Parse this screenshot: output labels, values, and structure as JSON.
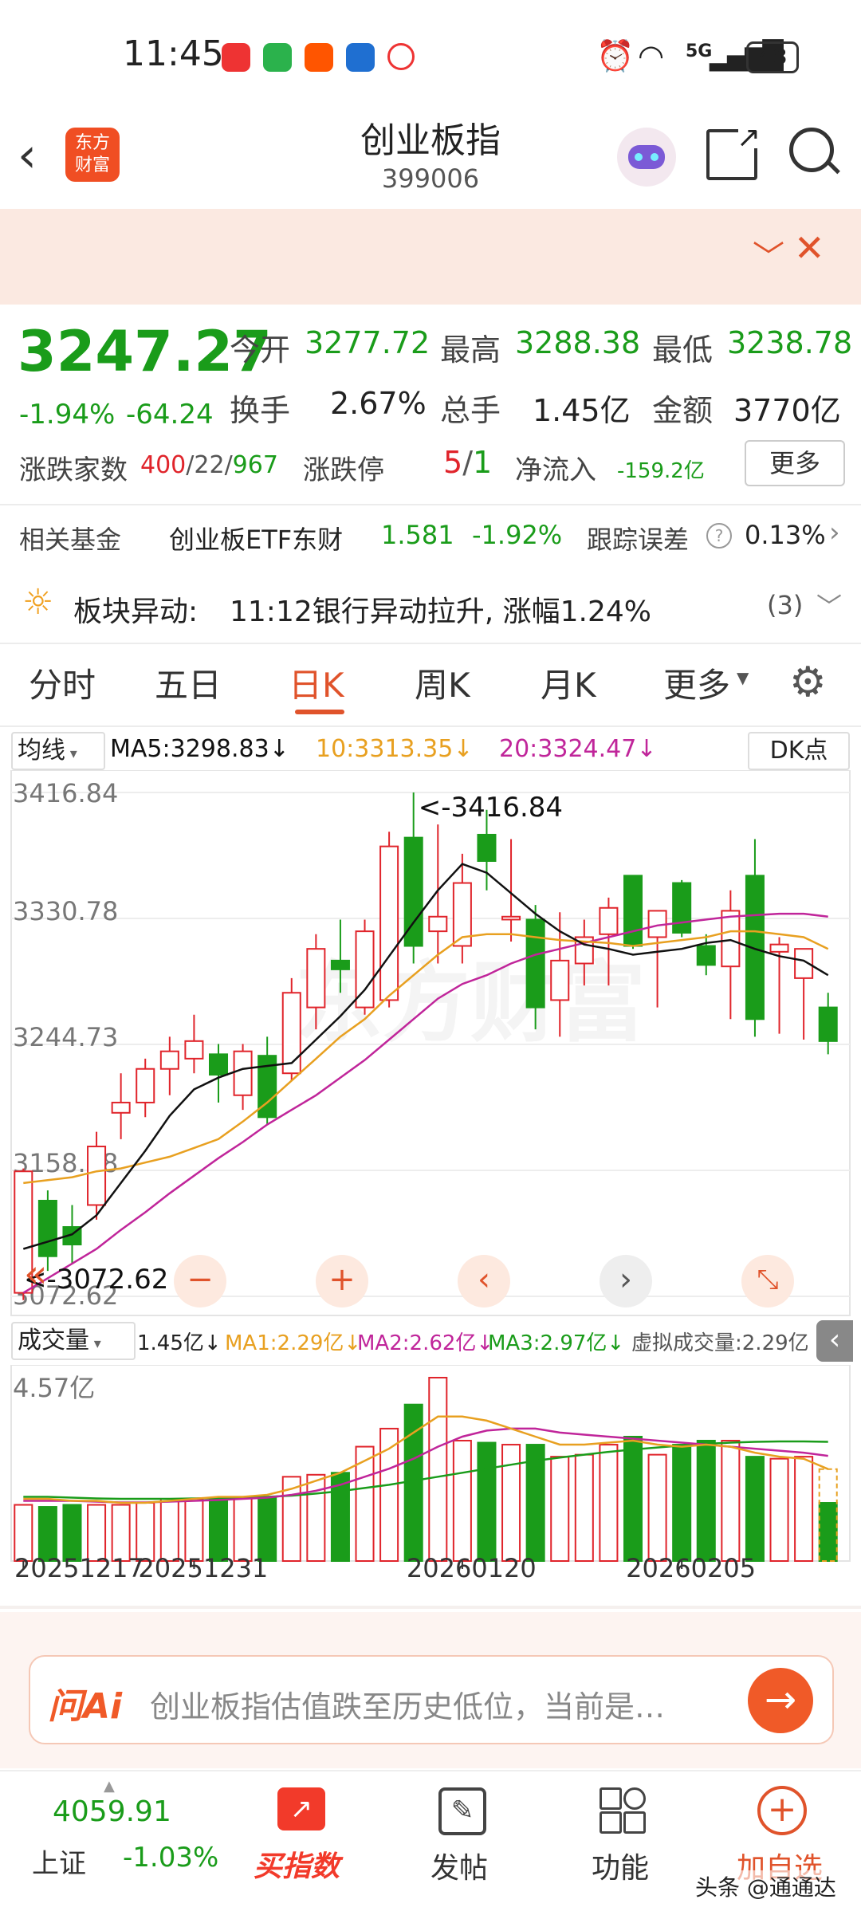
{
  "status_bar": {
    "time": "11:45",
    "signal": "5G",
    "battery": "48"
  },
  "header": {
    "title": "创业板指",
    "code": "399006",
    "logo_text": "东方财富"
  },
  "banner": {
    "clipped_text": "﹀"
  },
  "quote": {
    "price": "3247.27",
    "change_pct": "-1.94%",
    "change_abs": "-64.24",
    "open_label": "今开",
    "open_value": "3277.72",
    "high_label": "最高",
    "high_value": "3288.38",
    "low_label": "最低",
    "low_value": "3238.78",
    "turnover_label": "换手",
    "turnover_value": "2.67%",
    "volume_label": "总手",
    "volume_value": "1.45亿",
    "amount_label": "金额",
    "amount_value": "3770亿",
    "breadth_label": "涨跌家数",
    "breadth_up": "400",
    "breadth_flat": "22",
    "breadth_down": "967",
    "limit_label": "涨跌停",
    "limit_up": "5",
    "limit_down": "1",
    "netflow_label": "净流入",
    "netflow_value": "-159.2亿",
    "more_button": "更多"
  },
  "fund": {
    "label": "相关基金",
    "name": "创业板ETF东财",
    "price": "1.581",
    "change": "-1.92%",
    "track_label": "跟踪误差",
    "track_value": "0.13%"
  },
  "alert": {
    "label": "板块异动:",
    "text": "11:12银行异动拉升, 涨幅1.24%",
    "count": "(3)"
  },
  "tabs": [
    "分时",
    "五日",
    "日K",
    "周K",
    "月K",
    "更多"
  ],
  "active_tab": "日K",
  "ma_bar": {
    "selector": "均线",
    "ma5": "MA5:3298.83↓",
    "ma10": "10:3313.35↓",
    "ma20": "20:3324.47↓",
    "dk": "DK点"
  },
  "vol_bar": {
    "selector": "成交量",
    "vol": "1.45亿↓",
    "ma1": "MA1:2.29亿↓",
    "ma2": "MA2:2.62亿↓",
    "ma3": "MA3:2.97亿↓",
    "virtual": "虚拟成交量:2.29亿"
  },
  "chart_data": {
    "type": "candlestick",
    "price_axis": [
      "3416.84",
      "3330.78",
      "3244.73",
      "3158.68",
      "3072.62"
    ],
    "high_marker": "<-3416.84",
    "low_marker": "<-3072.62",
    "volume_axis_max": "4.57亿",
    "date_labels": [
      "20251217",
      "20251231",
      "20260120",
      "20260205"
    ],
    "colors": {
      "up": "#e0242b",
      "down": "#1a9c1a",
      "ma5": "#111111",
      "ma10": "#e8a020",
      "ma20": "#c0259a"
    },
    "candles": [
      {
        "o": 3075,
        "h": 3160,
        "l": 3070,
        "c": 3158
      },
      {
        "o": 3138,
        "h": 3145,
        "l": 3090,
        "c": 3100
      },
      {
        "o": 3120,
        "h": 3135,
        "l": 3095,
        "c": 3108
      },
      {
        "o": 3135,
        "h": 3185,
        "l": 3125,
        "c": 3175
      },
      {
        "o": 3198,
        "h": 3225,
        "l": 3180,
        "c": 3205
      },
      {
        "o": 3205,
        "h": 3235,
        "l": 3195,
        "c": 3228
      },
      {
        "o": 3228,
        "h": 3250,
        "l": 3210,
        "c": 3240
      },
      {
        "o": 3235,
        "h": 3265,
        "l": 3225,
        "c": 3247
      },
      {
        "o": 3238,
        "h": 3245,
        "l": 3205,
        "c": 3224
      },
      {
        "o": 3210,
        "h": 3245,
        "l": 3200,
        "c": 3240
      },
      {
        "o": 3237,
        "h": 3250,
        "l": 3190,
        "c": 3195
      },
      {
        "o": 3225,
        "h": 3290,
        "l": 3220,
        "c": 3280
      },
      {
        "o": 3270,
        "h": 3320,
        "l": 3255,
        "c": 3310
      },
      {
        "o": 3302,
        "h": 3330,
        "l": 3280,
        "c": 3296
      },
      {
        "o": 3270,
        "h": 3330,
        "l": 3265,
        "c": 3322
      },
      {
        "o": 3275,
        "h": 3390,
        "l": 3270,
        "c": 3380
      },
      {
        "o": 3386,
        "h": 3416.84,
        "l": 3300,
        "c": 3312
      },
      {
        "o": 3322,
        "h": 3395,
        "l": 3300,
        "c": 3332
      },
      {
        "o": 3312,
        "h": 3375,
        "l": 3300,
        "c": 3355
      },
      {
        "o": 3388,
        "h": 3405,
        "l": 3350,
        "c": 3370
      },
      {
        "o": 3330,
        "h": 3385,
        "l": 3315,
        "c": 3332
      },
      {
        "o": 3330,
        "h": 3340,
        "l": 3255,
        "c": 3270
      },
      {
        "o": 3275,
        "h": 3335,
        "l": 3250,
        "c": 3302
      },
      {
        "o": 3300,
        "h": 3330,
        "l": 3285,
        "c": 3318
      },
      {
        "o": 3320,
        "h": 3345,
        "l": 3285,
        "c": 3338
      },
      {
        "o": 3360,
        "h": 3360,
        "l": 3310,
        "c": 3312
      },
      {
        "o": 3318,
        "h": 3335,
        "l": 3270,
        "c": 3336
      },
      {
        "o": 3355,
        "h": 3357,
        "l": 3318,
        "c": 3321
      },
      {
        "o": 3312,
        "h": 3320,
        "l": 3292,
        "c": 3299
      },
      {
        "o": 3298,
        "h": 3350,
        "l": 3262,
        "c": 3336
      },
      {
        "o": 3360,
        "h": 3385,
        "l": 3250,
        "c": 3262
      },
      {
        "o": 3308,
        "h": 3318,
        "l": 3252,
        "c": 3313
      },
      {
        "o": 3290,
        "h": 3308,
        "l": 3248,
        "c": 3310
      },
      {
        "o": 3270,
        "h": 3280,
        "l": 3238,
        "c": 3247
      }
    ],
    "volumes": [
      1.4,
      1.35,
      1.4,
      1.4,
      1.4,
      1.45,
      1.55,
      1.55,
      1.55,
      1.6,
      1.6,
      2.1,
      2.15,
      2.2,
      2.85,
      3.3,
      3.9,
      4.57,
      3.0,
      2.95,
      2.9,
      2.9,
      2.6,
      2.65,
      2.9,
      3.1,
      2.65,
      2.9,
      3.0,
      3.0,
      2.6,
      2.55,
      2.6,
      1.45
    ],
    "ma5": [
      3105,
      3110,
      3115,
      3128,
      3150,
      3172,
      3196,
      3214,
      3222,
      3228,
      3230,
      3232,
      3248,
      3264,
      3282,
      3305,
      3328,
      3350,
      3368,
      3362,
      3348,
      3334,
      3322,
      3313,
      3310,
      3306,
      3308,
      3310,
      3314,
      3316,
      3310,
      3305,
      3302,
      3292
    ],
    "ma10": [
      3150,
      3152,
      3154,
      3158,
      3160,
      3164,
      3168,
      3174,
      3180,
      3192,
      3205,
      3220,
      3235,
      3250,
      3262,
      3278,
      3292,
      3306,
      3318,
      3320,
      3320,
      3318,
      3316,
      3315,
      3314,
      3312,
      3314,
      3316,
      3318,
      3322,
      3322,
      3320,
      3318,
      3310
    ],
    "ma20": [
      3075,
      3085,
      3095,
      3105,
      3118,
      3130,
      3143,
      3155,
      3167,
      3178,
      3190,
      3200,
      3210,
      3222,
      3234,
      3248,
      3262,
      3276,
      3286,
      3292,
      3300,
      3306,
      3310,
      3314,
      3318,
      3322,
      3326,
      3328,
      3330,
      3332,
      3333,
      3334,
      3334,
      3332
    ],
    "vol_ma1": [
      1.55,
      1.55,
      1.5,
      1.5,
      1.45,
      1.45,
      1.5,
      1.55,
      1.6,
      1.6,
      1.65,
      1.8,
      2.0,
      2.2,
      2.5,
      2.8,
      3.2,
      3.6,
      3.6,
      3.5,
      3.3,
      3.1,
      2.9,
      2.9,
      2.95,
      3.0,
      2.9,
      2.85,
      2.9,
      2.85,
      2.7,
      2.6,
      2.55,
      2.29
    ],
    "vol_ma2": [
      1.5,
      1.5,
      1.5,
      1.48,
      1.46,
      1.46,
      1.48,
      1.5,
      1.52,
      1.55,
      1.58,
      1.65,
      1.75,
      1.9,
      2.1,
      2.3,
      2.55,
      2.85,
      3.1,
      3.25,
      3.3,
      3.3,
      3.2,
      3.15,
      3.1,
      3.05,
      3.0,
      2.95,
      2.9,
      2.85,
      2.8,
      2.75,
      2.7,
      2.62
    ],
    "vol_ma3": [
      1.6,
      1.6,
      1.58,
      1.56,
      1.55,
      1.55,
      1.55,
      1.56,
      1.57,
      1.58,
      1.6,
      1.63,
      1.68,
      1.74,
      1.82,
      1.9,
      2.0,
      2.1,
      2.2,
      2.3,
      2.4,
      2.5,
      2.58,
      2.65,
      2.72,
      2.78,
      2.83,
      2.88,
      2.92,
      2.95,
      2.97,
      2.98,
      2.98,
      2.97
    ]
  },
  "ai_bar": {
    "brand": "问Ai",
    "prompt": "创业板指估值跌至历史低位，当前是…"
  },
  "bottom_nav": {
    "index_value": "4059.91",
    "index_name": "上证",
    "index_change": "-1.03%",
    "buy_label": "买指数",
    "post_label": "发帖",
    "func_label": "功能",
    "watch_label": "加自选"
  },
  "watermark": "头条 @通通达"
}
